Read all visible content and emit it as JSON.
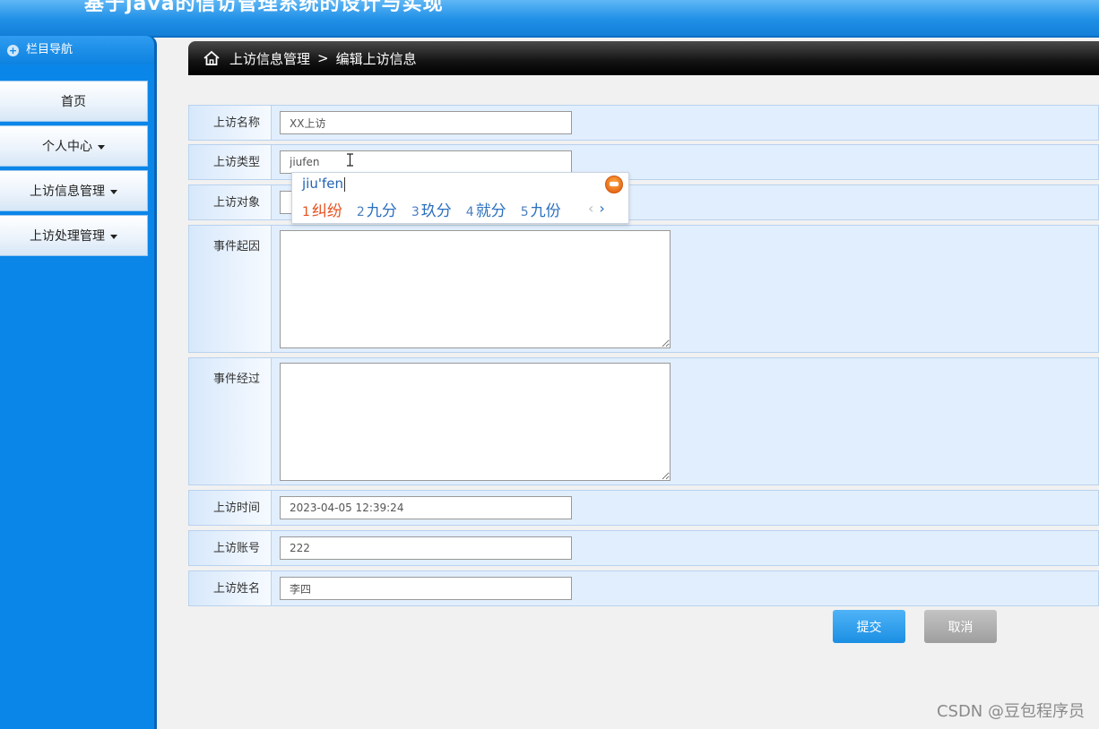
{
  "header": {
    "title": "基于java的信访管理系统的设计与实现"
  },
  "sidebar": {
    "heading": "栏目导航",
    "items": [
      {
        "label": "首页",
        "has_dropdown": false
      },
      {
        "label": "个人中心",
        "has_dropdown": true
      },
      {
        "label": "上访信息管理",
        "has_dropdown": true
      },
      {
        "label": "上访处理管理",
        "has_dropdown": true
      }
    ]
  },
  "breadcrumb": {
    "section": "上访信息管理",
    "separator": ">",
    "page": "编辑上访信息"
  },
  "form": {
    "fields": {
      "name": {
        "label": "上访名称",
        "value": "XX上访"
      },
      "type": {
        "label": "上访类型",
        "value": "jiufen"
      },
      "target": {
        "label": "上访对象",
        "value": ""
      },
      "cause": {
        "label": "事件起因",
        "value": ""
      },
      "process": {
        "label": "事件经过",
        "value": ""
      },
      "time": {
        "label": "上访时间",
        "value": "2023-04-05 12:39:24"
      },
      "account": {
        "label": "上访账号",
        "value": "222"
      },
      "person": {
        "label": "上访姓名",
        "value": "李四"
      }
    },
    "submit_label": "提交",
    "cancel_label": "取消"
  },
  "ime": {
    "pinyin": "jiu'fen",
    "candidates": [
      {
        "num": "1",
        "text": "纠纷"
      },
      {
        "num": "2",
        "text": "九分"
      },
      {
        "num": "3",
        "text": "玖分"
      },
      {
        "num": "4",
        "text": "就分"
      },
      {
        "num": "5",
        "text": "九份"
      }
    ],
    "prev_arrow": "‹",
    "next_arrow": "›"
  },
  "watermark": "CSDN @豆包程序员",
  "colors": {
    "sidebar_bg": "#0a86e8",
    "banner": "#1f8fe6",
    "form_row_bg": "#e1eefd",
    "submit": "#1b8fe3",
    "cancel": "#9e9e9e",
    "ime_active": "#e55220"
  }
}
